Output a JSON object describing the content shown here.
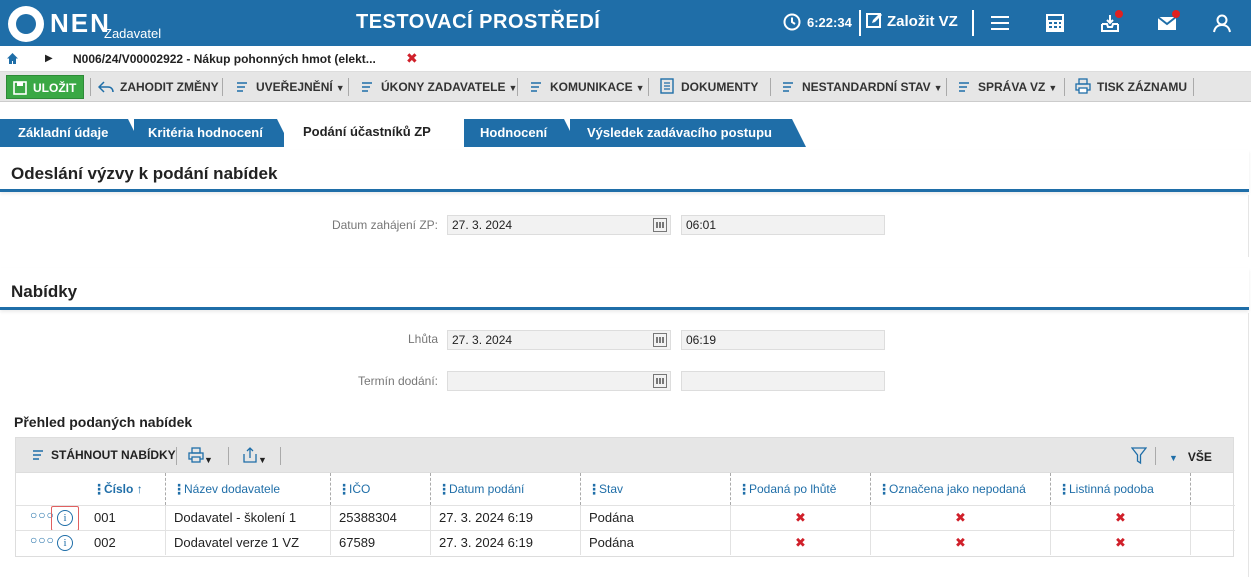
{
  "header": {
    "logo_text": "NEN",
    "logo_sub": "Zadavatel",
    "env_title": "TESTOVACÍ PROSTŘEDÍ",
    "clock": "6:22:34",
    "create_label": "Založit VZ"
  },
  "breadcrumb": {
    "text": "N006/24/V00002922 - Nákup pohonných hmot (elekt...",
    "close": "✖"
  },
  "toolbar": {
    "save": "ULOŽIT",
    "discard": "ZAHODIT ZMĚNY",
    "publish": "UVEŘEJNĚNÍ",
    "actions": "ÚKONY ZADAVATELE",
    "communication": "KOMUNIKACE",
    "documents": "DOKUMENTY",
    "nonstandard": "NESTANDARDNÍ STAV",
    "manage": "SPRÁVA VZ",
    "print": "TISK ZÁZNAMU"
  },
  "tabs": [
    {
      "label": "Základní údaje"
    },
    {
      "label": "Kritéria hodnocení"
    },
    {
      "label": "Podání účastníků ZP"
    },
    {
      "label": "Hodnocení"
    },
    {
      "label": "Výsledek zadávacího postupu"
    }
  ],
  "section1": {
    "title": "Odeslání výzvy k podání nabídek",
    "start_label": "Datum zahájení ZP:",
    "start_date": "27. 3. 2024",
    "start_time": "06:01"
  },
  "section2": {
    "title": "Nabídky",
    "deadline_label": "Lhůta",
    "deadline_date": "27. 3. 2024",
    "deadline_time": "06:19",
    "delivery_label": "Termín dodání:",
    "delivery_date": "",
    "delivery_time": ""
  },
  "grid": {
    "title": "Přehled podaných nabídek",
    "download": "STÁHNOUT NABÍDKY",
    "filter_all": "VŠE",
    "columns": [
      "Číslo",
      "Název dodavatele",
      "IČO",
      "Datum podání",
      "Stav",
      "Podaná po lhůtě",
      "Označena jako nepodaná",
      "Listinná podoba"
    ],
    "sort_arrow": "↑",
    "rows": [
      {
        "number": "001",
        "supplier": "Dodavatel - školení 1",
        "ico": "25388304",
        "date": "27. 3. 2024 6:19",
        "status": "Podána",
        "late": "✖",
        "not_submitted": "✖",
        "paper": "✖"
      },
      {
        "number": "002",
        "supplier": "Dodavatel verze 1 VZ",
        "ico": "67589",
        "date": "27. 3. 2024 6:19",
        "status": "Podána",
        "late": "✖",
        "not_submitted": "✖",
        "paper": "✖"
      }
    ]
  }
}
